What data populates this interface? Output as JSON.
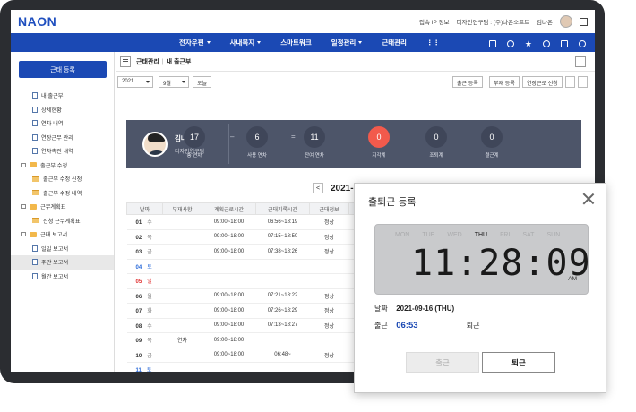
{
  "app": {
    "logo": "NAON",
    "colors": {
      "brand": "#1b49b4",
      "summary_bg": "#4d5569",
      "highlight": "#f25a4c"
    }
  },
  "topbar": {
    "links": [
      "접속 IP 정보",
      "디자인연구팀 : (주)나온소프트",
      "김나온"
    ]
  },
  "nav": {
    "items": [
      "전자우편",
      "사내복지",
      "스마트워크",
      "일정관리",
      "근태관리"
    ],
    "icons": [
      "pen-icon",
      "chat-icon",
      "star-icon",
      "search-icon",
      "monitor-icon",
      "palette-icon"
    ]
  },
  "sidebar": {
    "primary_button": "근태 등록",
    "menu": [
      {
        "label": "내 출근부",
        "type": "doc",
        "level": 1
      },
      {
        "label": "상세현황",
        "type": "doc",
        "level": 1
      },
      {
        "label": "연차 내역",
        "type": "doc",
        "level": 1
      },
      {
        "label": "연장근무 관리",
        "type": "doc",
        "level": 1
      },
      {
        "label": "연차촉진 내역",
        "type": "doc",
        "level": 1
      },
      {
        "label": "출근부 수정",
        "type": "folder",
        "level": 0
      },
      {
        "label": "출근부 수정 신청",
        "type": "folder-open",
        "level": 1
      },
      {
        "label": "출근부 수정 내역",
        "type": "folder-open",
        "level": 1
      },
      {
        "label": "근무계획표",
        "type": "folder",
        "level": 0
      },
      {
        "label": "신청 근무계획표",
        "type": "folder-open",
        "level": 1
      },
      {
        "label": "근태 보고서",
        "type": "folder",
        "level": 0
      },
      {
        "label": "일일 보고서",
        "type": "doc",
        "level": 1
      },
      {
        "label": "주간 보고서",
        "type": "doc",
        "level": 1,
        "active": true
      },
      {
        "label": "월간 보고서",
        "type": "doc",
        "level": 1
      }
    ]
  },
  "breadcrumb": {
    "section": "근태관리",
    "page": "내 출근부"
  },
  "filters": {
    "year": "2021",
    "month": "9월",
    "today_button": "오늘"
  },
  "actions": {
    "register": "출근 등록",
    "absence": "부재 등록",
    "overtime": "연장근로 신청"
  },
  "profile": {
    "name": "김나온",
    "title": "차장",
    "dept": "디자인연구팀"
  },
  "stats": [
    {
      "value": "17",
      "label": "총 연차"
    },
    {
      "value": "6",
      "label": "사용 연차"
    },
    {
      "value": "11",
      "label": "잔여 연차"
    },
    {
      "value": "0",
      "label": "지각계",
      "highlight": true
    },
    {
      "value": "0",
      "label": "조퇴계"
    },
    {
      "value": "0",
      "label": "결근계"
    }
  ],
  "month_nav": {
    "label": "2021-09",
    "prev": "<",
    "next": ">"
  },
  "table": {
    "headers": [
      "날짜",
      "부재사항",
      "계획근로시간",
      "근태기록시간",
      "근태정보"
    ],
    "rows": [
      {
        "day": "01",
        "dow": "수",
        "absence": "",
        "planned": "09:00~18:00",
        "recorded": "06:56~18:19",
        "status": "정상",
        "color": ""
      },
      {
        "day": "02",
        "dow": "목",
        "absence": "",
        "planned": "09:00~18:00",
        "recorded": "07:15~18:50",
        "status": "정상",
        "color": ""
      },
      {
        "day": "03",
        "dow": "금",
        "absence": "",
        "planned": "09:00~18:00",
        "recorded": "07:38~18:26",
        "status": "정상",
        "color": ""
      },
      {
        "day": "04",
        "dow": "토",
        "absence": "",
        "planned": "",
        "recorded": "",
        "status": "",
        "color": "blue"
      },
      {
        "day": "05",
        "dow": "일",
        "absence": "",
        "planned": "",
        "recorded": "",
        "status": "",
        "color": "red"
      },
      {
        "day": "06",
        "dow": "월",
        "absence": "",
        "planned": "09:00~18:00",
        "recorded": "07:21~18:22",
        "status": "정상",
        "color": ""
      },
      {
        "day": "07",
        "dow": "화",
        "absence": "",
        "planned": "09:00~18:00",
        "recorded": "07:26~18:29",
        "status": "정상",
        "color": ""
      },
      {
        "day": "08",
        "dow": "수",
        "absence": "",
        "planned": "09:00~18:00",
        "recorded": "07:13~18:27",
        "status": "정상",
        "color": ""
      },
      {
        "day": "09",
        "dow": "목",
        "absence": "연차",
        "planned": "09:00~18:00",
        "recorded": "",
        "status": "",
        "color": ""
      },
      {
        "day": "10",
        "dow": "금",
        "absence": "",
        "planned": "09:00~18:00",
        "recorded": "06:48~",
        "status": "정상",
        "color": ""
      },
      {
        "day": "11",
        "dow": "토",
        "absence": "",
        "planned": "",
        "recorded": "",
        "status": "",
        "color": "blue"
      }
    ]
  },
  "modal": {
    "title": "출퇴근 등록",
    "weekdays": [
      "MON",
      "TUE",
      "WED",
      "THU",
      "FRI",
      "SAT",
      "SUN"
    ],
    "active_weekday": "THU",
    "time": "11:28:09",
    "ampm": "AM",
    "date_label": "날짜",
    "date_value": "2021-09-16 (THU)",
    "in_label": "출근",
    "in_time": "06:53",
    "out_label": "퇴근",
    "btn_in": "출근",
    "btn_out": "퇴근"
  }
}
